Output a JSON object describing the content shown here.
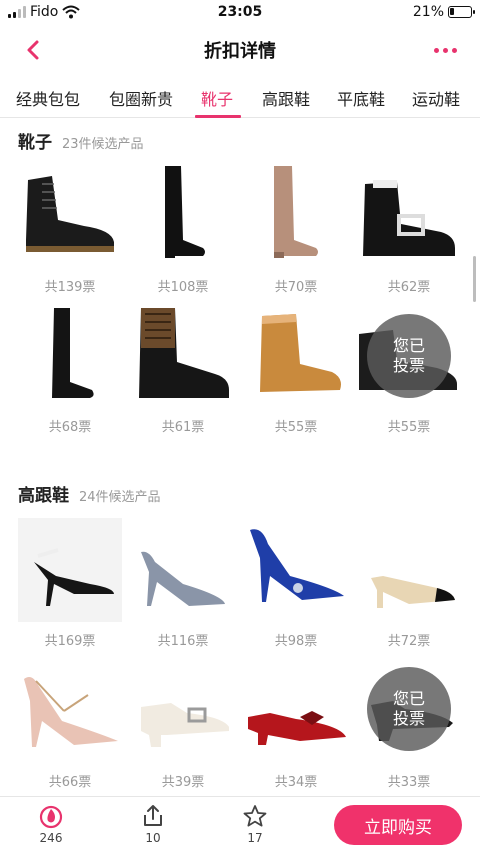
{
  "status_bar": {
    "carrier": "Fido",
    "time": "23:05",
    "battery": "21%",
    "battery_level": 0.21
  },
  "header": {
    "title": "折扣详情"
  },
  "tabs": [
    {
      "label": "经典包包"
    },
    {
      "label": "包圈新贵"
    },
    {
      "label": "靴子",
      "active": true
    },
    {
      "label": "高跟鞋"
    },
    {
      "label": "平底鞋"
    },
    {
      "label": "运动鞋"
    }
  ],
  "sections": [
    {
      "title": "靴子",
      "count": "23件候选产品",
      "items": [
        {
          "votes": "共139票",
          "icon": "combat-boot"
        },
        {
          "votes": "共108票",
          "icon": "over-knee-boot"
        },
        {
          "votes": "共70票",
          "icon": "over-knee-boot-beige"
        },
        {
          "votes": "共62票",
          "icon": "buckle-boot"
        },
        {
          "votes": "共68票",
          "icon": "tall-boot"
        },
        {
          "votes": "共61票",
          "icon": "sock-boot"
        },
        {
          "votes": "共55票",
          "icon": "ugg-boot"
        },
        {
          "votes": "共55票",
          "icon": "ankle-boot",
          "voted": true
        }
      ]
    },
    {
      "title": "高跟鞋",
      "count": "24件候选产品",
      "items": [
        {
          "votes": "共169票",
          "icon": "slingback-pump"
        },
        {
          "votes": "共116票",
          "icon": "glitter-pump"
        },
        {
          "votes": "共98票",
          "icon": "blue-satin-pump"
        },
        {
          "votes": "共72票",
          "icon": "two-tone-slingback"
        },
        {
          "votes": "共66票",
          "icon": "studded-pump"
        },
        {
          "votes": "共39票",
          "icon": "buckle-loafer"
        },
        {
          "votes": "共34票",
          "icon": "red-bow-pump"
        },
        {
          "votes": "共33票",
          "icon": "block-heel",
          "voted": true
        }
      ]
    }
  ],
  "voted_badge": "您已投票",
  "voted_badge_line1": "您已",
  "voted_badge_line2": "投票",
  "bottom_bar": {
    "like_count": "246",
    "share_count": "10",
    "fav_count": "17",
    "buy_label": "立即购买"
  },
  "colors": {
    "accent": "#e8336d",
    "buy": "#f0326b"
  }
}
